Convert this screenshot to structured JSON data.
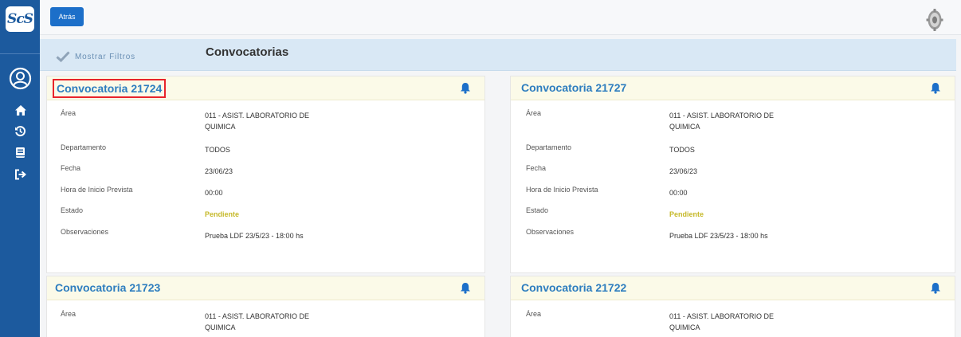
{
  "sidebar": {
    "logo_text": "ScS",
    "nav": [
      "home-icon",
      "history-icon",
      "book-icon",
      "logout-icon"
    ]
  },
  "topbar": {
    "back_label": "Atrás"
  },
  "filterbar": {
    "toggle_label": "Mostrar Filtros",
    "title": "Convocatorias"
  },
  "labels": {
    "area": "Área",
    "departamento": "Departamento",
    "fecha": "Fecha",
    "hora": "Hora de Inicio Prevista",
    "estado": "Estado",
    "observaciones": "Observaciones"
  },
  "cards": [
    {
      "title": "Convocatoria 21724",
      "area_line1": "011 - ASIST. LABORATORIO DE",
      "area_line2": "QUIMICA",
      "departamento": "TODOS",
      "fecha": "23/06/23",
      "hora": "00:00",
      "estado": "Pendiente",
      "observaciones": "Prueba LDF 23/5/23 - 18:00 hs"
    },
    {
      "title": "Convocatoria 21727",
      "area_line1": "011 - ASIST. LABORATORIO DE",
      "area_line2": "QUIMICA",
      "departamento": "TODOS",
      "fecha": "23/06/23",
      "hora": "00:00",
      "estado": "Pendiente",
      "observaciones": "Prueba LDF 23/5/23 - 18:00 hs"
    },
    {
      "title": "Convocatoria 21723",
      "area_line1": "011 - ASIST. LABORATORIO DE",
      "area_line2": "QUIMICA"
    },
    {
      "title": "Convocatoria 21722",
      "area_line1": "011 - ASIST. LABORATORIO DE",
      "area_line2": "QUIMICA"
    }
  ],
  "colors": {
    "sidebar": "#1c5a9e",
    "primary": "#1c6fc9",
    "card_title": "#2d7dbf",
    "status_pending": "#c6b92a",
    "highlight": "#e8242b"
  }
}
